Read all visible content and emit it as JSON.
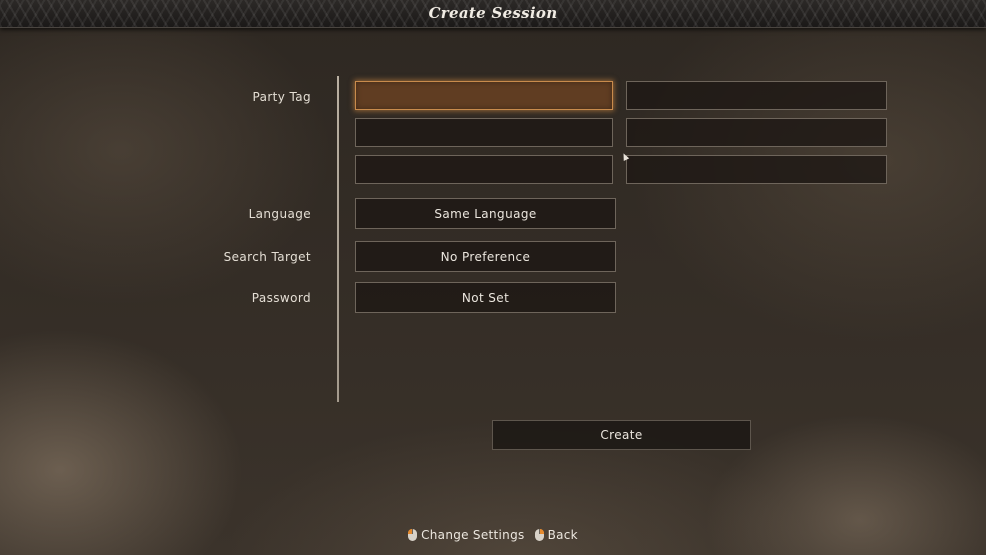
{
  "header": {
    "title": "Create Session"
  },
  "form": {
    "party_tag_label": "Party Tag",
    "language_label": "Language",
    "language_value": "Same Language",
    "search_target_label": "Search Target",
    "search_target_value": "No Preference",
    "password_label": "Password",
    "password_value": "Not Set",
    "party_tag_slots": [
      "",
      "",
      "",
      "",
      "",
      ""
    ],
    "selected_slot": 1
  },
  "create_button_label": "Create",
  "footer": {
    "change_settings_label": "Change Settings",
    "change_settings_icon": "mouse-left-click-icon",
    "back_label": "Back",
    "back_icon": "mouse-right-click-icon"
  },
  "colors": {
    "selected_field_fill": "#603d22",
    "selected_field_glow": "#c98b4c",
    "hint_accent": "#e58a2e"
  }
}
